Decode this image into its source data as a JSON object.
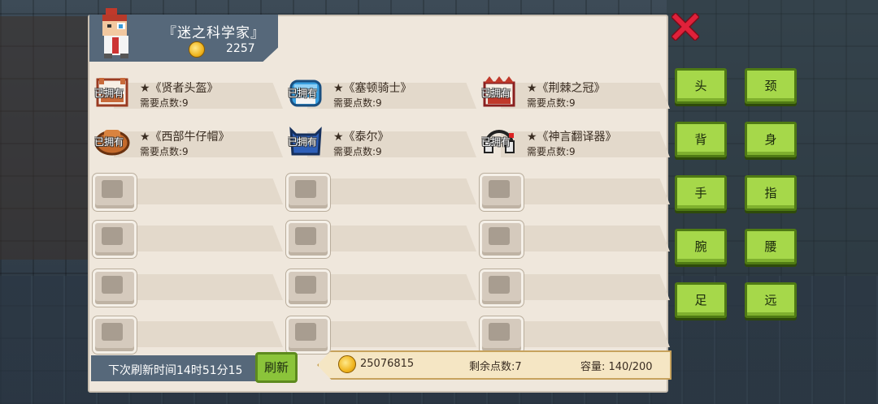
{
  "shop": {
    "title": "『迷之科学家』",
    "coins": "2257"
  },
  "items": [
    {
      "name": "★《贤者头盔》",
      "cost": "需要点数:9",
      "owned": "已拥有",
      "color": "#c86a3a"
    },
    {
      "name": "★《塞顿骑士》",
      "cost": "需要点数:9",
      "owned": "已拥有",
      "color": "#3aa0e0"
    },
    {
      "name": "★《荆棘之冠》",
      "cost": "需要点数:9",
      "owned": "已拥有",
      "color": "#c0392b"
    },
    {
      "name": "★《西部牛仔帽》",
      "cost": "需要点数:9",
      "owned": "已拥有",
      "color": "#c46a2c"
    },
    {
      "name": "★《泰尔》",
      "cost": "需要点数:9",
      "owned": "已拥有",
      "color": "#2e5fb8"
    },
    {
      "name": "★《神言翻译器》",
      "cost": "需要点数:9",
      "owned": "已拥有",
      "color": "#e8e8e8"
    }
  ],
  "footer": {
    "refresh_time": "下次刷新时间14时51分15",
    "refresh_button": "刷新",
    "total_coins": "25076815",
    "remaining_points": "剩余点数:7",
    "capacity": "容量:  140/200"
  },
  "categories": [
    "头",
    "颈",
    "背",
    "身",
    "手",
    "指",
    "腕",
    "腰",
    "足",
    "远"
  ]
}
